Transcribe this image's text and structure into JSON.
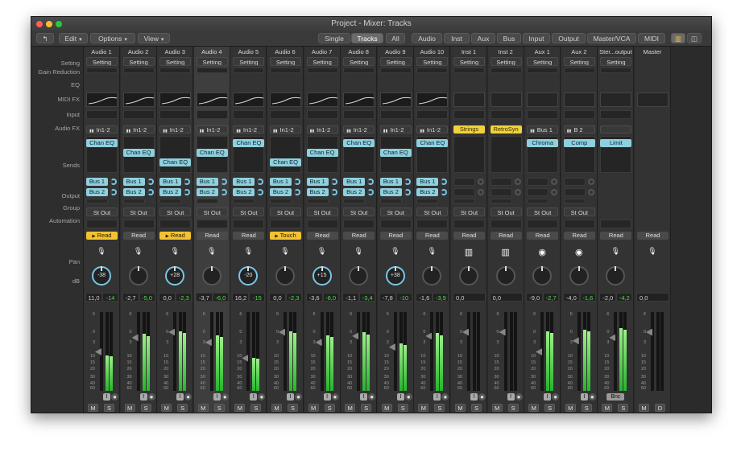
{
  "window": {
    "title": "Project - Mixer: Tracks"
  },
  "toolbar": {
    "menus": [
      "Edit",
      "Options",
      "View"
    ],
    "mode_tabs": [
      "Single",
      "Tracks",
      "All"
    ],
    "filter_tabs": [
      "Audio",
      "Inst",
      "Aux",
      "Bus",
      "Input",
      "Output",
      "Master/VCA",
      "MIDI"
    ],
    "selected_mode": "Tracks"
  },
  "row_labels": {
    "setting": "Setting",
    "gain_reduction": "Gain Reduction",
    "eq": "EQ",
    "midi_fx": "MIDI FX",
    "input": "Input",
    "audio_fx": "Audio FX",
    "sends": "Sends",
    "output": "Output",
    "group": "Group",
    "automation": "Automation",
    "pan": "Pan",
    "db": "dB"
  },
  "fader_scale": [
    "6",
    "0",
    "3",
    "10",
    "15",
    "20",
    "30",
    "40",
    "60"
  ],
  "meter_scale": [
    "0",
    "3",
    "6",
    "9",
    "12",
    "18",
    "24",
    "30",
    "35",
    "40",
    "45",
    "50",
    "60"
  ],
  "colors": {
    "audio": "#2f62a8",
    "inst": "#2ea43c",
    "aux": "#a8a22a",
    "stereo_out": "#a43498",
    "master": "#6e3aa2",
    "plugin": "#8fd0de",
    "meter": "#3ed046",
    "automation_active": "#f2c230"
  },
  "channels": [
    {
      "name": "Audio 1",
      "setting": "Setting",
      "eq": true,
      "input": "In1-2",
      "fx": [
        {
          "label": "Chan EQ",
          "row": 0
        }
      ],
      "sends": [
        "Bus 1",
        "Bus 2"
      ],
      "output": "St Out",
      "automation": "Read",
      "auto_active": true,
      "icon": "mic-icon",
      "pan": "-38",
      "db_a": "11,0",
      "db_b": "-14",
      "level": 0.45,
      "fader": 0.5,
      "track": "Audio 1",
      "color": "audio",
      "selected": false
    },
    {
      "name": "Audio 2",
      "setting": "Setting",
      "eq": true,
      "input": "In1-2",
      "fx": [
        {
          "label": "Chan EQ",
          "row": 1
        }
      ],
      "sends": [
        "Bus 1",
        "Bus 2"
      ],
      "output": "St Out",
      "automation": "Read",
      "auto_active": false,
      "icon": "mic-icon",
      "pan": "",
      "db_a": "-2,7",
      "db_b": "-5,0",
      "level": 0.72,
      "fader": 0.32,
      "track": "Audio 2",
      "color": "audio",
      "selected": false
    },
    {
      "name": "Audio 3",
      "setting": "Setting",
      "eq": true,
      "input": "In1-2",
      "fx": [
        {
          "label": "Chan EQ",
          "row": 2
        }
      ],
      "sends": [
        "Bus 1",
        "Bus 2"
      ],
      "output": "St Out",
      "automation": "Read",
      "auto_active": true,
      "icon": "mic-icon",
      "pan": "+28",
      "db_a": "0,0",
      "db_b": "-2,3",
      "level": 0.76,
      "fader": 0.25,
      "track": "Audio 3",
      "color": "audio",
      "selected": false
    },
    {
      "name": "Audio 4",
      "setting": "Setting",
      "eq": true,
      "input": "In1-2",
      "fx": [
        {
          "label": "Chan EQ",
          "row": 1
        }
      ],
      "sends": [
        "Bus 1",
        "Bus 2"
      ],
      "output": "St Out",
      "automation": "Read",
      "auto_active": false,
      "icon": "mic-icon",
      "pan": "",
      "db_a": "-3,7",
      "db_b": "-6,0",
      "level": 0.7,
      "fader": 0.38,
      "track": "Audio 4",
      "color": "audio",
      "selected": true
    },
    {
      "name": "Audio 5",
      "setting": "Setting",
      "eq": true,
      "input": "In1-2",
      "fx": [
        {
          "label": "Chan EQ",
          "row": 0
        }
      ],
      "sends": [
        "Bus 1",
        "Bus 2"
      ],
      "output": "St Out",
      "automation": "Read",
      "auto_active": false,
      "icon": "mic-icon",
      "pan": "-20",
      "db_a": "16,2",
      "db_b": "-15",
      "level": 0.42,
      "fader": 0.58,
      "track": "Audio 5",
      "color": "audio",
      "selected": false
    },
    {
      "name": "Audio 6",
      "setting": "Setting",
      "eq": true,
      "input": "In1-2",
      "fx": [
        {
          "label": "Chan EQ",
          "row": 2
        }
      ],
      "sends": [
        "Bus 1",
        "Bus 2"
      ],
      "output": "St Out",
      "automation": "Touch",
      "auto_active": true,
      "icon": "mic-icon",
      "pan": "",
      "db_a": "0,0",
      "db_b": "-2,3",
      "level": 0.76,
      "fader": 0.25,
      "track": "Audio 6",
      "color": "audio",
      "selected": false
    },
    {
      "name": "Audio 7",
      "setting": "Setting",
      "eq": true,
      "input": "In1-2",
      "fx": [
        {
          "label": "Chan EQ",
          "row": 1
        }
      ],
      "sends": [
        "Bus 1",
        "Bus 2"
      ],
      "output": "St Out",
      "automation": "Read",
      "auto_active": false,
      "icon": "mic-icon",
      "pan": "+15",
      "db_a": "-3,6",
      "db_b": "-6,0",
      "level": 0.7,
      "fader": 0.38,
      "track": "Audio 7",
      "color": "audio",
      "selected": false
    },
    {
      "name": "Audio 8",
      "setting": "Setting",
      "eq": true,
      "input": "In1-2",
      "fx": [
        {
          "label": "Chan EQ",
          "row": 0
        }
      ],
      "sends": [
        "Bus 1",
        "Bus 2"
      ],
      "output": "St Out",
      "automation": "Read",
      "auto_active": false,
      "icon": "mic-icon",
      "pan": "",
      "db_a": "-1,1",
      "db_b": "-3,4",
      "level": 0.74,
      "fader": 0.3,
      "track": "Audio 8",
      "color": "audio",
      "selected": false
    },
    {
      "name": "Audio 9",
      "setting": "Setting",
      "eq": true,
      "input": "In1-2",
      "fx": [
        {
          "label": "Chan EQ",
          "row": 1
        }
      ],
      "sends": [
        "Bus 1",
        "Bus 2"
      ],
      "output": "St Out",
      "automation": "Read",
      "auto_active": false,
      "icon": "mic-icon",
      "pan": "+38",
      "db_a": "-7,8",
      "db_b": "-10",
      "level": 0.6,
      "fader": 0.44,
      "track": "Audio 9",
      "color": "audio",
      "selected": false
    },
    {
      "name": "Audio 10",
      "setting": "Setting",
      "eq": true,
      "input": "In1-2",
      "fx": [
        {
          "label": "Chan EQ",
          "row": 0
        }
      ],
      "sends": [
        "Bus 1",
        "Bus 2"
      ],
      "output": "St Out",
      "automation": "Read",
      "auto_active": false,
      "icon": "mic-icon",
      "pan": "",
      "db_a": "-1,6",
      "db_b": "-3,9",
      "level": 0.73,
      "fader": 0.3,
      "track": "Audio 10",
      "color": "audio",
      "selected": false
    },
    {
      "name": "Inst 1",
      "setting": "Setting",
      "eq": false,
      "input": "Strings",
      "fx": [],
      "sends": [
        "",
        ""
      ],
      "output": "St Out",
      "automation": "Read",
      "auto_active": false,
      "icon": "keyboard-icon",
      "pan": "",
      "db_a": "0,0",
      "db_b": "",
      "level": 0.0,
      "fader": 0.25,
      "track": "Inst 1",
      "color": "inst",
      "selected": false
    },
    {
      "name": "Inst 2",
      "setting": "Setting",
      "eq": false,
      "input": "RetroSyn",
      "fx": [],
      "sends": [
        "",
        ""
      ],
      "output": "St Out",
      "automation": "Read",
      "auto_active": false,
      "icon": "keyboard-icon",
      "pan": "",
      "db_a": "0,0",
      "db_b": "",
      "level": 0.0,
      "fader": 0.25,
      "track": "Inst 2",
      "color": "inst",
      "selected": false
    },
    {
      "name": "Aux 1",
      "setting": "Setting",
      "eq": false,
      "input": "Bus 1",
      "fx": [
        {
          "label": "Chroma",
          "row": 0
        }
      ],
      "sends": [
        "",
        ""
      ],
      "output": "St Out",
      "automation": "Read",
      "auto_active": false,
      "icon": "live-icon",
      "pan": "",
      "db_a": "-9,0",
      "db_b": "-2,7",
      "level": 0.76,
      "fader": 0.5,
      "track": "Aux 1",
      "color": "aux",
      "selected": false
    },
    {
      "name": "Aux 2",
      "setting": "Setting",
      "eq": false,
      "input": "B 2",
      "fx": [
        {
          "label": "Comp",
          "row": 0
        }
      ],
      "sends": [
        "",
        ""
      ],
      "output": "St Out",
      "automation": "Read",
      "auto_active": false,
      "icon": "live-icon",
      "pan": "",
      "db_a": "-4,0",
      "db_b": "-1,6",
      "level": 0.78,
      "fader": 0.36,
      "track": "Aux 2",
      "color": "aux",
      "selected": false
    },
    {
      "name": "Ster...output",
      "setting": "Setting",
      "eq": false,
      "input": "",
      "fx": [
        {
          "label": "Limit",
          "row": 0
        }
      ],
      "sends": [],
      "output": "",
      "automation": "Read",
      "auto_active": false,
      "icon": "mic-icon",
      "pan": "",
      "db_a": "-2,0",
      "db_b": "-4,2",
      "level": 0.8,
      "fader": 0.32,
      "track": "Stereo Out",
      "color": "stereo_out",
      "selected": false,
      "bnc": "Bnc"
    },
    {
      "name": "Master",
      "setting": "",
      "eq": false,
      "input": "",
      "fx": [],
      "sends": [],
      "output": "",
      "automation": "Read",
      "auto_active": false,
      "icon": "mic-icon",
      "pan": "",
      "db_a": "0,0",
      "db_b": "",
      "level": 0.0,
      "fader": 0.25,
      "track": "Master",
      "color": "master",
      "selected": false,
      "master": true
    }
  ],
  "buttons": {
    "mute": "M",
    "solo": "S",
    "dim": "D",
    "input_mon": "I"
  }
}
